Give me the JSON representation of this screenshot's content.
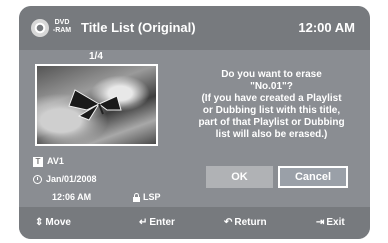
{
  "header": {
    "disc_type_line1": "DVD",
    "disc_type_line2": "-RAM",
    "title": "Title List (Original)",
    "clock": "12:00 AM"
  },
  "thumbnail": {
    "counter": "1/4",
    "source": "AV1",
    "date": "Jan/01/2008",
    "time": "12:06 AM",
    "mode": "LSP"
  },
  "dialog": {
    "message_lines": [
      "Do you want to erase",
      "\"No.01\"?",
      "(If you have created a Playlist",
      "or Dubbing list with this title,",
      "part of that Playlist or Dubbing",
      "list will also be erased.)"
    ],
    "ok_label": "OK",
    "cancel_label": "Cancel"
  },
  "footer": {
    "move_label": "Move",
    "enter_label": "Enter",
    "return_label": "Return",
    "exit_label": "Exit"
  },
  "icons": {
    "disc": "disc-icon",
    "av": "av-input-icon",
    "clock": "clock-icon",
    "lock": "lock-icon",
    "move": "up-down-arrows-icon",
    "enter": "enter-icon",
    "return": "return-icon",
    "exit": "exit-icon"
  }
}
